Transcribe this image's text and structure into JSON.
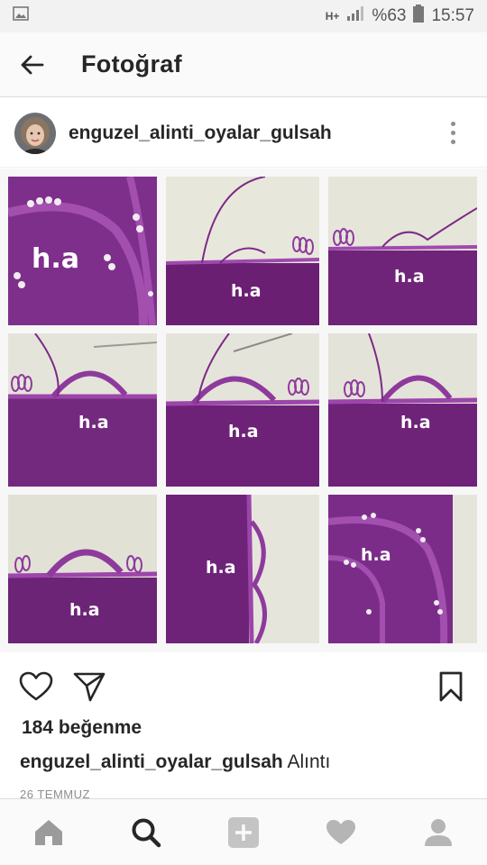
{
  "status_bar": {
    "network": "H+",
    "battery_percent": "%63",
    "time": "15:57"
  },
  "app_bar": {
    "title": "Fotoğraf"
  },
  "post": {
    "username": "enguzel_alinti_oyalar_gulsah",
    "photo_tiles": [
      {
        "label": "h.a"
      },
      {
        "label": "h.a"
      },
      {
        "label": "h.a"
      },
      {
        "label": "h.a"
      },
      {
        "label": "h.a"
      },
      {
        "label": "h.a"
      },
      {
        "label": "h.a"
      },
      {
        "label": "h.a"
      },
      {
        "label": "h.a"
      }
    ],
    "likes": "184 beğenme",
    "caption_user": "enguzel_alinti_oyalar_gulsah",
    "caption_text": "Alıntı",
    "date": "26 TEMMUZ"
  },
  "colors": {
    "purple": "#7b2d86",
    "purple_dark": "#5a1663",
    "cream": "#ecebdf",
    "icon_gray": "#9b9b9b",
    "icon_black": "#262626"
  },
  "nav_icons": [
    "home-icon",
    "search-icon",
    "add-icon",
    "heart-icon",
    "profile-icon"
  ]
}
